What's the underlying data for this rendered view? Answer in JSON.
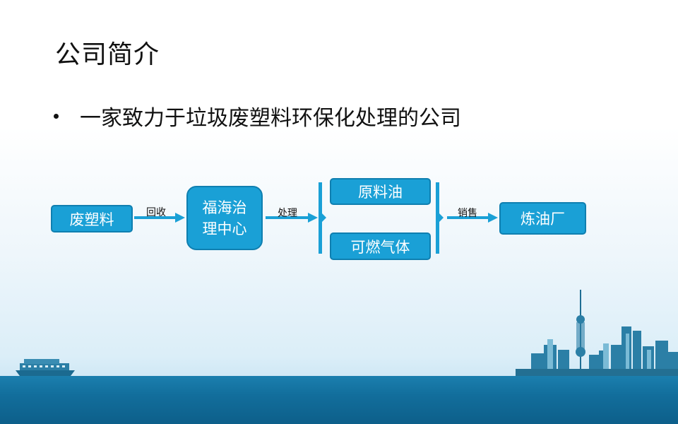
{
  "slide": {
    "title": "公司简介",
    "bullet": "一家致力于垃圾废塑料环保化处理的公司"
  },
  "flow": {
    "nodes": {
      "waste_plastic": "废塑料",
      "center_line1": "福海治",
      "center_line2": "理中心",
      "raw_oil": "原料油",
      "combustible_gas": "可燃气体",
      "refinery": "炼油厂"
    },
    "edges": {
      "recycle": "回收",
      "process": "处理",
      "sell": "销售"
    }
  },
  "colors": {
    "box_fill": "#1aa0d6",
    "box_border": "#0f7fb0",
    "sea": "#126e9c"
  }
}
